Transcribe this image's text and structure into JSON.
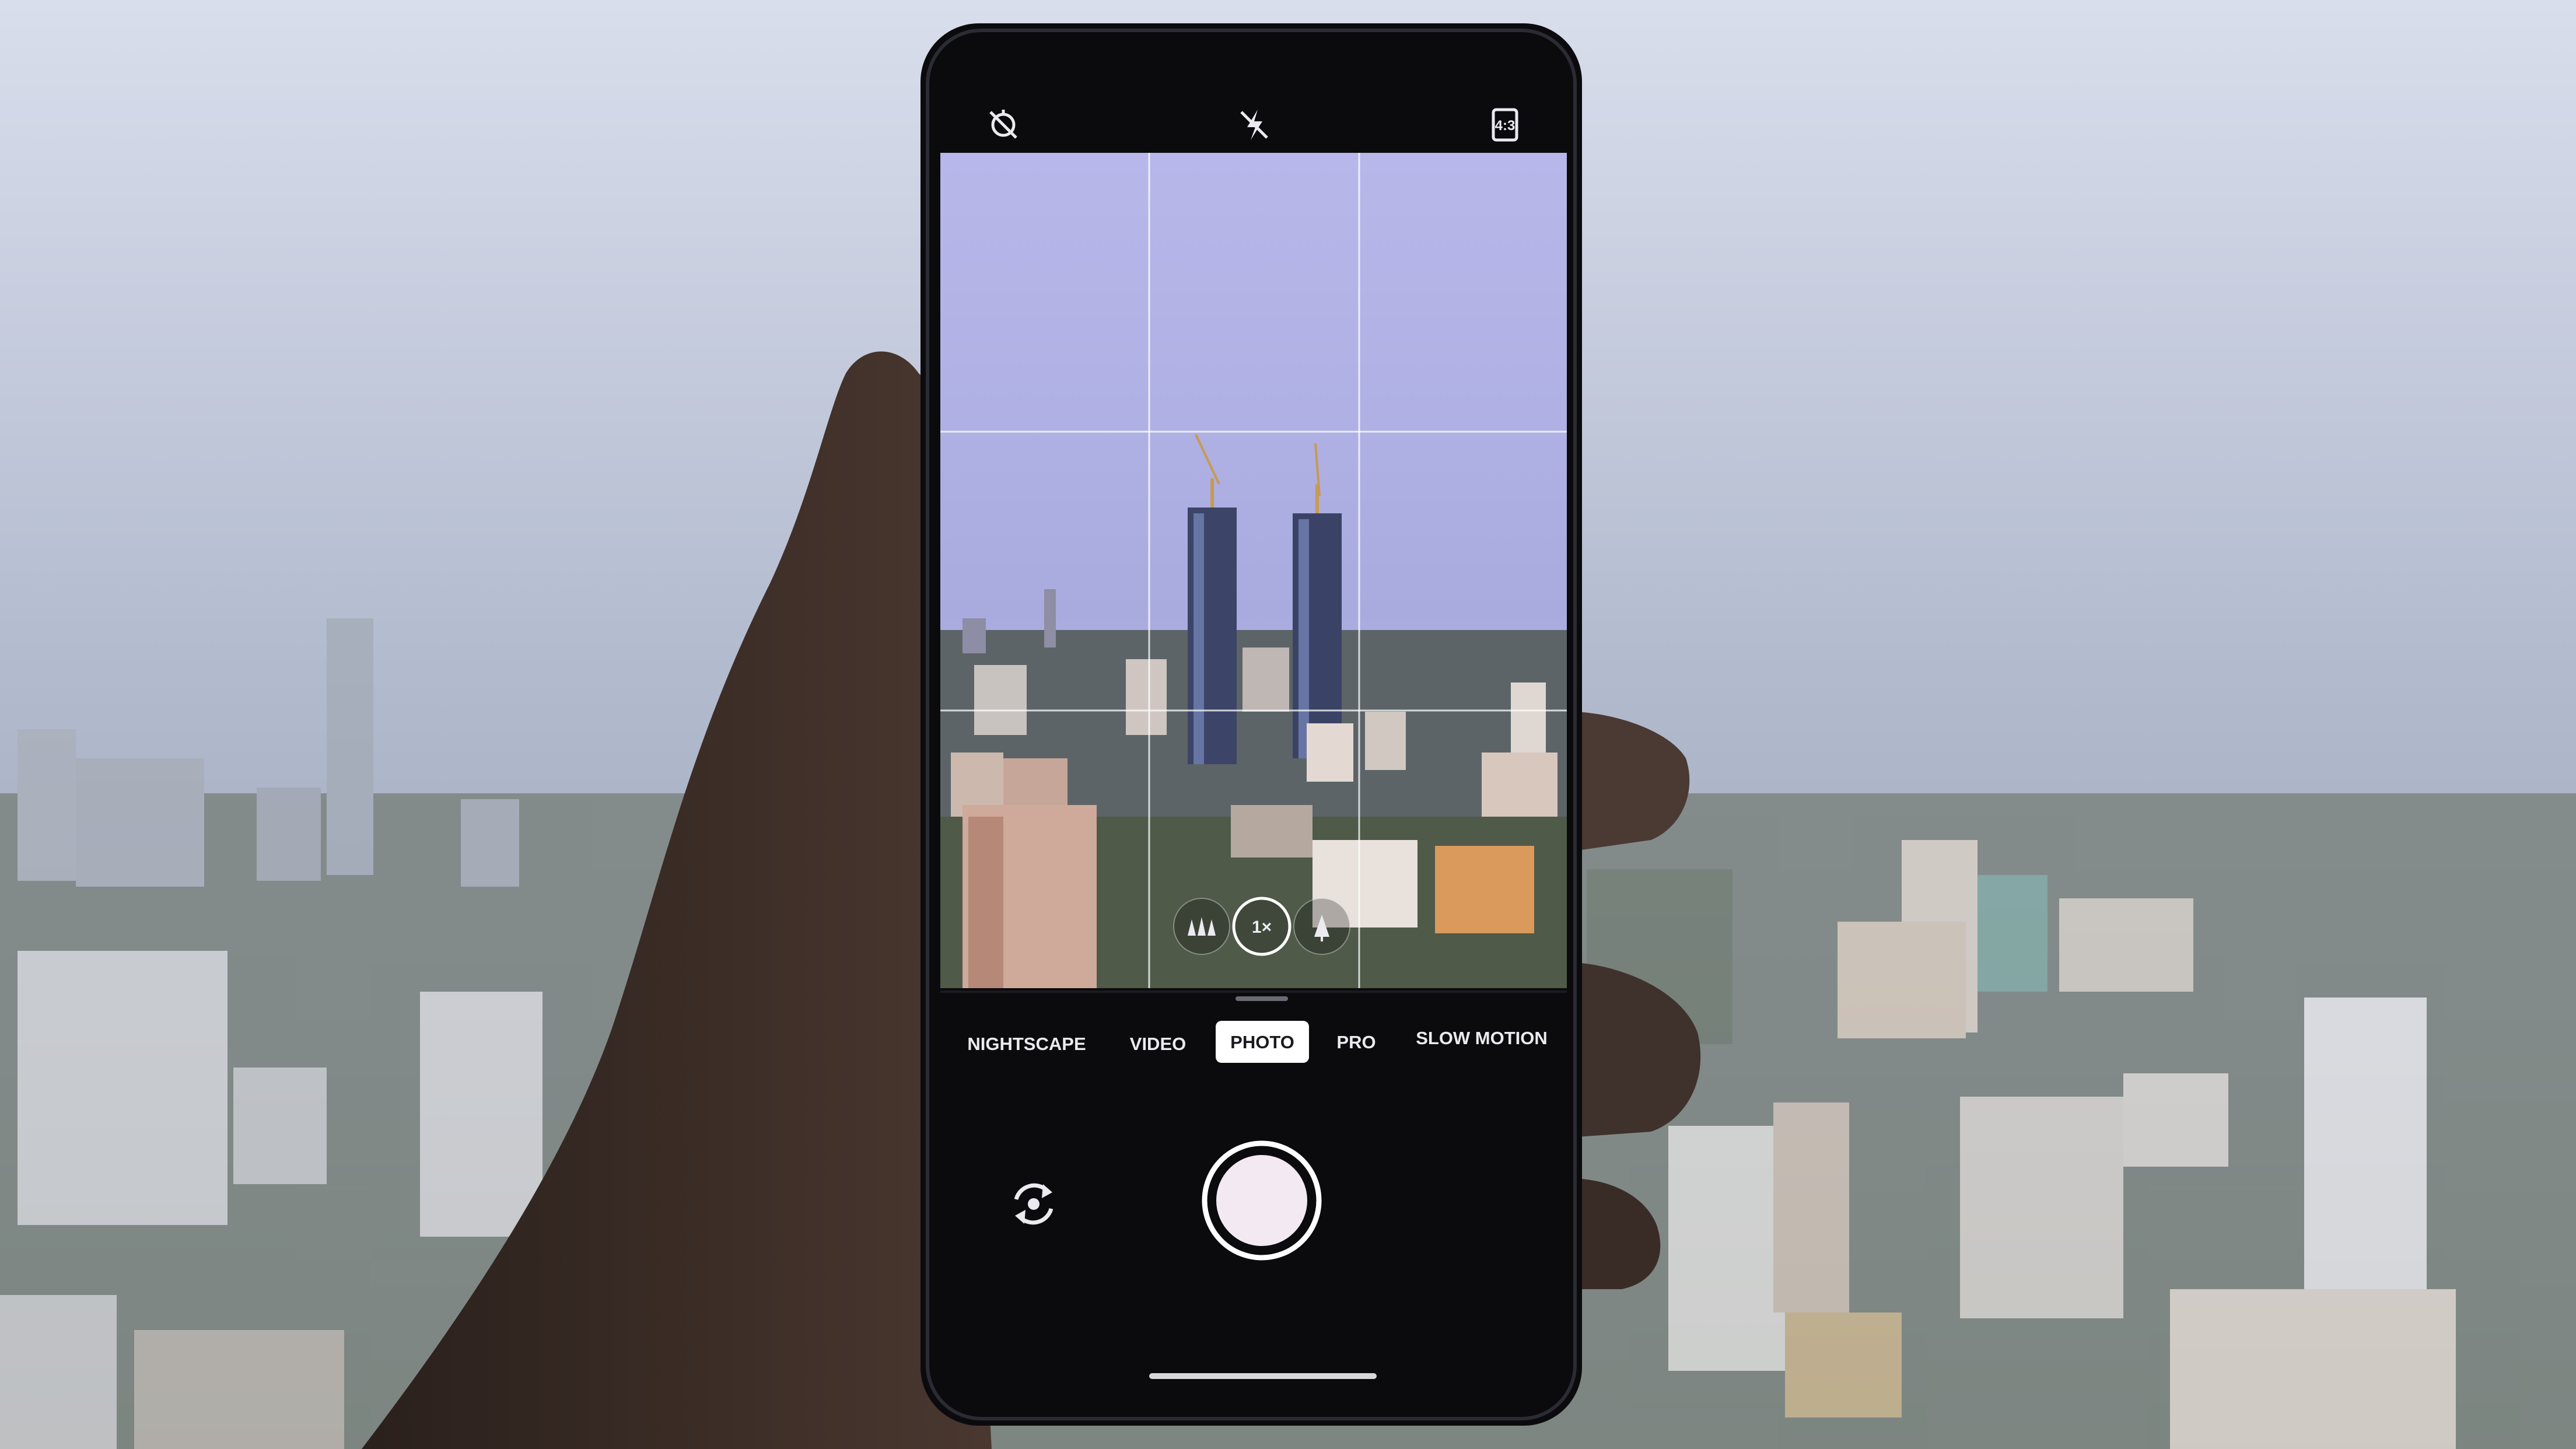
{
  "camera_app": {
    "top_bar": {
      "timer_icon": "timer-off-icon",
      "flash_icon": "flash-off-icon",
      "aspect_ratio_label": "4:3"
    },
    "zoom": {
      "multi_tree_icon": "wide-angle-icon",
      "current_zoom": "1×",
      "single_tree_icon": "telephoto-icon"
    },
    "modes": [
      {
        "label": "NIGHTSCAPE",
        "selected": false
      },
      {
        "label": "VIDEO",
        "selected": false
      },
      {
        "label": "PHOTO",
        "selected": true
      },
      {
        "label": "PRO",
        "selected": false
      },
      {
        "label": "SLOW MOTION",
        "selected": false
      }
    ],
    "bottom_bar": {
      "flip_camera_icon": "switch-camera-icon",
      "shutter_icon": "shutter-button"
    }
  },
  "colors": {
    "sky": "#b9c0d6",
    "haze": "#9ea6b7",
    "phone_body": "#0b0b0e",
    "viewfinder_sky": "#b9b6e6",
    "selected_mode_bg": "#ffffff",
    "skin": "#3a2c26"
  }
}
